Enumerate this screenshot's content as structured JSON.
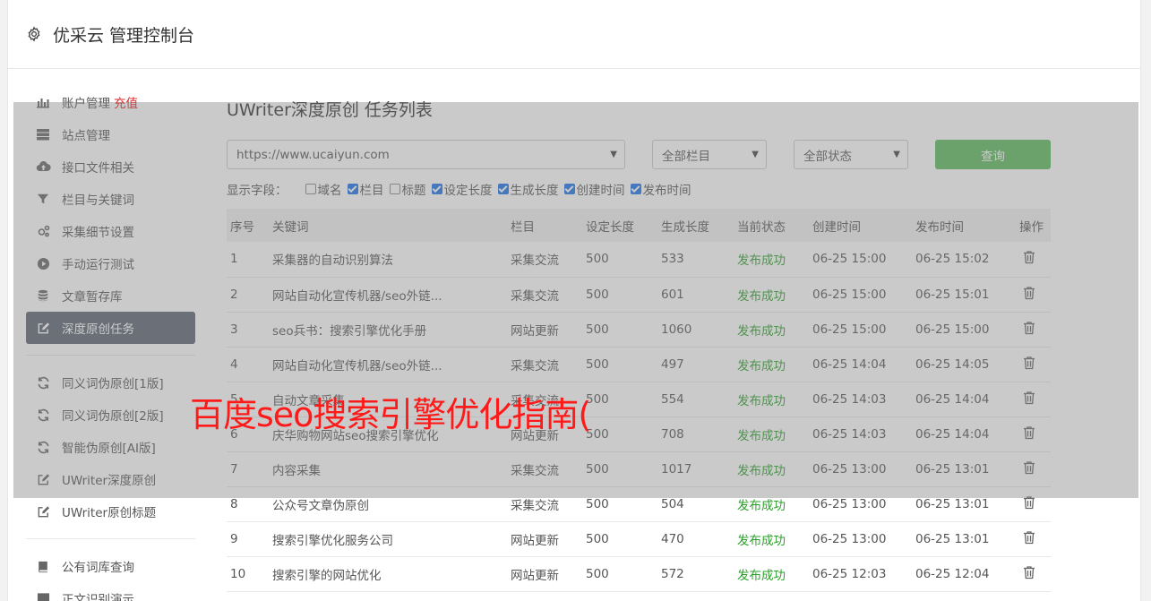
{
  "app": {
    "title": "优采云 管理控制台",
    "header_icon": "gear-icon"
  },
  "sidebar": {
    "items": [
      {
        "label": "账户管理",
        "badge": "充值",
        "icon": "bar-chart-icon"
      },
      {
        "label": "站点管理",
        "icon": "server-icon"
      },
      {
        "label": "接口文件相关",
        "icon": "cloud-upload-icon"
      },
      {
        "label": "栏目与关键词",
        "icon": "filter-icon"
      },
      {
        "label": "采集细节设置",
        "icon": "gears-icon"
      },
      {
        "label": "手动运行测试",
        "icon": "play-circle-icon"
      },
      {
        "label": "文章暂存库",
        "icon": "database-icon"
      },
      {
        "label": "深度原创任务",
        "icon": "edit-icon",
        "active": true
      }
    ],
    "items2": [
      {
        "label": "同义词伪原创[1版]",
        "icon": "refresh-icon"
      },
      {
        "label": "同义词伪原创[2版]",
        "icon": "refresh-icon"
      },
      {
        "label": "智能伪原创[AI版]",
        "icon": "refresh-icon"
      },
      {
        "label": "UWriter深度原创",
        "icon": "edit-icon"
      },
      {
        "label": "UWriter原创标题",
        "icon": "edit-icon"
      }
    ],
    "items3": [
      {
        "label": "公有词库查询",
        "icon": "book-icon"
      },
      {
        "label": "正文识别演示",
        "icon": "monitor-icon"
      }
    ]
  },
  "main": {
    "title": "UWriter深度原创 任务列表",
    "site_select": "https://www.ucaiyun.com",
    "column_select": "全部栏目",
    "status_select": "全部状态",
    "query_button": "查询",
    "fields_label": "显示字段：",
    "fields": [
      {
        "label": "域名",
        "checked": false
      },
      {
        "label": "栏目",
        "checked": true
      },
      {
        "label": "标题",
        "checked": false
      },
      {
        "label": "设定长度",
        "checked": true
      },
      {
        "label": "生成长度",
        "checked": true
      },
      {
        "label": "创建时间",
        "checked": true
      },
      {
        "label": "发布时间",
        "checked": true
      }
    ],
    "columns": [
      "序号",
      "关键词",
      "栏目",
      "设定长度",
      "生成长度",
      "当前状态",
      "创建时间",
      "发布时间",
      "操作"
    ],
    "rows": [
      [
        "1",
        "采集器的自动识别算法",
        "采集交流",
        "500",
        "533",
        "发布成功",
        "06-25 15:00",
        "06-25 15:02"
      ],
      [
        "2",
        "网站自动化宣传机器/seo外链...",
        "采集交流",
        "500",
        "601",
        "发布成功",
        "06-25 15:00",
        "06-25 15:01"
      ],
      [
        "3",
        "seo兵书：搜索引擎优化手册",
        "网站更新",
        "500",
        "1060",
        "发布成功",
        "06-25 15:00",
        "06-25 15:00"
      ],
      [
        "4",
        "网站自动化宣传机器/seo外链...",
        "采集交流",
        "500",
        "497",
        "发布成功",
        "06-25 14:04",
        "06-25 14:05"
      ],
      [
        "5",
        "自动文章采集",
        "采集交流",
        "500",
        "554",
        "发布成功",
        "06-25 14:03",
        "06-25 14:04"
      ],
      [
        "6",
        "庆华购物网站seo搜索引擎优化",
        "网站更新",
        "500",
        "708",
        "发布成功",
        "06-25 14:03",
        "06-25 14:04"
      ],
      [
        "7",
        "内容采集",
        "采集交流",
        "500",
        "1017",
        "发布成功",
        "06-25 13:00",
        "06-25 13:01"
      ],
      [
        "8",
        "公众号文章伪原创",
        "采集交流",
        "500",
        "504",
        "发布成功",
        "06-25 13:00",
        "06-25 13:01"
      ],
      [
        "9",
        "搜索引擎优化服务公司",
        "网站更新",
        "500",
        "470",
        "发布成功",
        "06-25 13:00",
        "06-25 13:01"
      ],
      [
        "10",
        "搜索引擎的网站优化",
        "网站更新",
        "500",
        "572",
        "发布成功",
        "06-25 12:03",
        "06-25 12:04"
      ]
    ],
    "row_action_icon": "trash-icon"
  },
  "watermark": "百度seo搜索引擎优化指南(",
  "colors": {
    "active_sidebar": "#5b6273",
    "query_button": "#5cb85c",
    "success_text": "#2aa12a",
    "recharge_text": "#e02020",
    "watermark_text": "#ff1a1a"
  }
}
